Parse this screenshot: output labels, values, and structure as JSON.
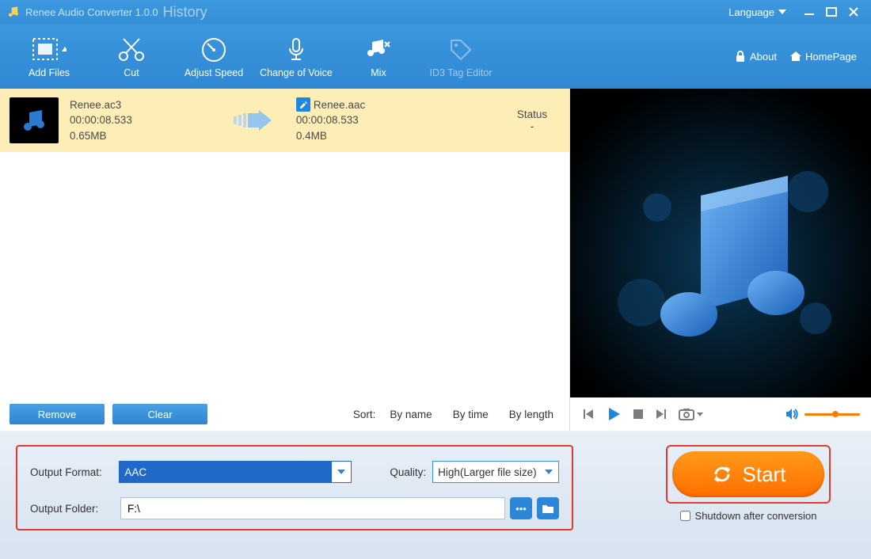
{
  "titlebar": {
    "app_name": "Renee Audio Converter 1.0.0",
    "history_link": "History",
    "language_label": "Language"
  },
  "toolbar": {
    "add_files": "Add Files",
    "cut": "Cut",
    "adjust_speed": "Adjust Speed",
    "change_voice": "Change of Voice",
    "mix": "Mix",
    "id3_editor": "ID3 Tag Editor",
    "about": "About",
    "homepage": "HomePage"
  },
  "file_item": {
    "src_name": "Renee.ac3",
    "src_duration": "00:00:08.533",
    "src_size": "0.65MB",
    "dst_name": "Renee.aac",
    "dst_duration": "00:00:08.533",
    "dst_size": "0.4MB",
    "status_header": "Status",
    "status_value": "-"
  },
  "list_footer": {
    "remove": "Remove",
    "clear": "Clear",
    "sort_label": "Sort:",
    "by_name": "By name",
    "by_time": "By time",
    "by_length": "By length"
  },
  "settings": {
    "output_format_label": "Output Format:",
    "output_format_value": "AAC",
    "quality_label": "Quality:",
    "quality_value": "High(Larger file size)",
    "output_folder_label": "Output Folder:",
    "output_folder_value": "F:\\"
  },
  "start": {
    "button_label": "Start",
    "shutdown_label": "Shutdown after conversion"
  }
}
